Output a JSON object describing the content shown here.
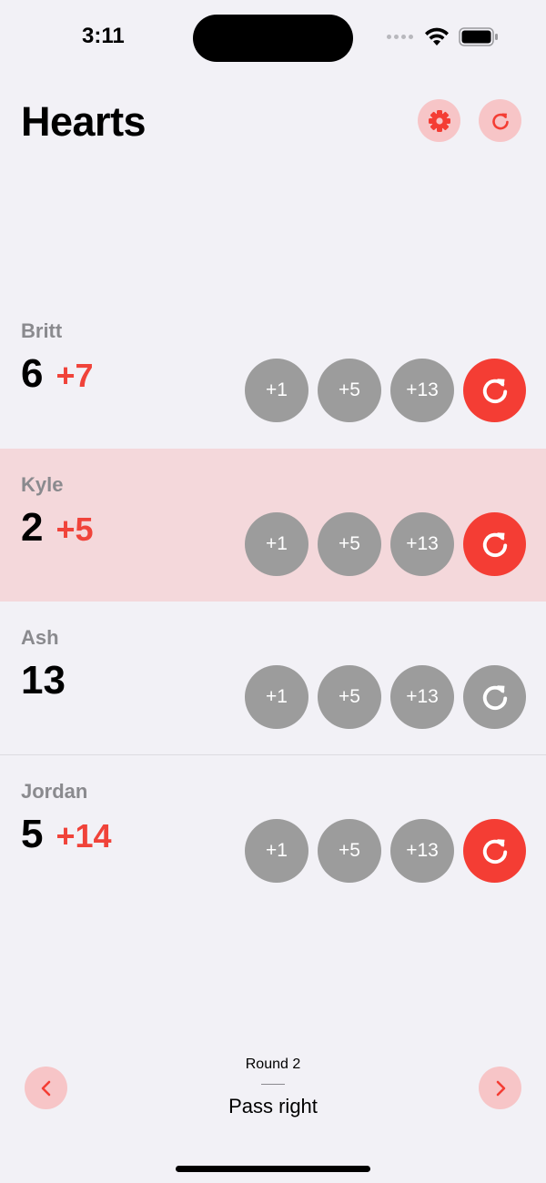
{
  "status_bar": {
    "time": "3:11",
    "icons": [
      "cellular-dots-icon",
      "wifi-icon",
      "battery-icon"
    ]
  },
  "header": {
    "title": "Hearts",
    "settings_icon": "gear-icon",
    "reset_icon": "rotate-clockwise-icon"
  },
  "players": [
    {
      "name": "Britt",
      "score": "6",
      "pending": "+7",
      "highlighted": false
    },
    {
      "name": "Kyle",
      "score": "2",
      "pending": "+5",
      "highlighted": true
    },
    {
      "name": "Ash",
      "score": "13",
      "pending": "",
      "highlighted": false
    },
    {
      "name": "Jordan",
      "score": "5",
      "pending": "+14",
      "highlighted": false
    }
  ],
  "point_buttons": [
    "+1",
    "+5",
    "+13"
  ],
  "footer": {
    "round_label": "Round 2",
    "pass_label": "Pass right",
    "prev_icon": "chevron-left-icon",
    "next_icon": "chevron-right-icon"
  },
  "colors": {
    "accent": "#f43d34",
    "accent_light": "#f7c5c7",
    "pending_text": "#f0433a",
    "button_gray": "#9c9c9c",
    "highlight_row": "#f4d8db",
    "background": "#f2f1f6"
  }
}
